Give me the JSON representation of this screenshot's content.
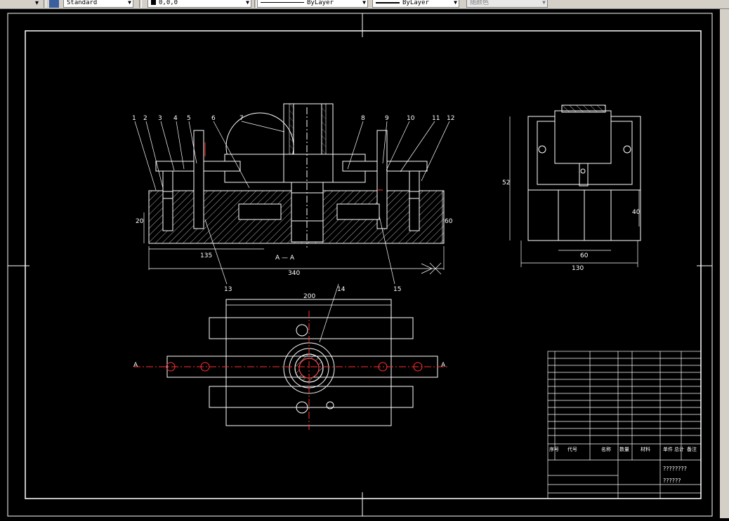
{
  "toolbar": {
    "text_style": "Standard",
    "color_value": "0,0,0",
    "linetype": "ByLayer",
    "lineweight": "ByLayer",
    "plot_color": "随颜色"
  },
  "drawing": {
    "balloons": [
      "1",
      "2",
      "3",
      "4",
      "5",
      "6",
      "7",
      "8",
      "9",
      "10",
      "11",
      "12",
      "13",
      "14",
      "15"
    ],
    "section_label": "A — A",
    "section_marks": [
      "A",
      "A"
    ],
    "dims": {
      "d135": "135",
      "d340": "340",
      "d20": "20",
      "d60a": "60",
      "d200": "200",
      "d52": "52",
      "d40": "40",
      "d60b": "60",
      "d130": "130"
    },
    "title_block": {
      "parts_header": [
        "序号",
        "代号",
        "名称",
        "数量",
        "材料",
        "单件",
        "总计",
        "备注"
      ],
      "title_text": "????????",
      "drawing_no": "??????"
    }
  }
}
